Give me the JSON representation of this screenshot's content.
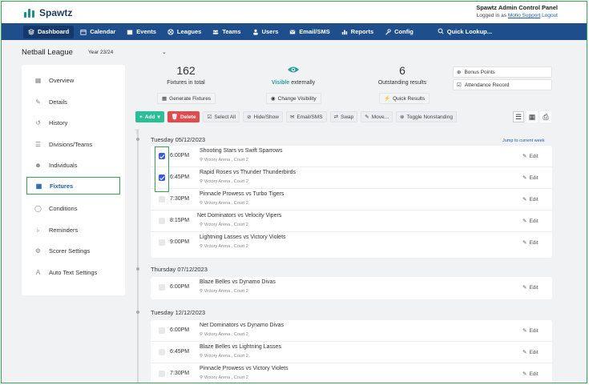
{
  "app": {
    "brand": "Spawtz",
    "admin_title": "Spawtz Admin Control Panel",
    "logged_prefix": "Logged in as",
    "user": "Motio Support",
    "logout": "Logout"
  },
  "nav": [
    {
      "label": "Dashboard",
      "icon": "layers-icon"
    },
    {
      "label": "Calendar",
      "icon": "calendar-icon"
    },
    {
      "label": "Events",
      "icon": "events-icon"
    },
    {
      "label": "Leagues",
      "icon": "ball-icon"
    },
    {
      "label": "Teams",
      "icon": "teams-icon"
    },
    {
      "label": "Users",
      "icon": "user-icon"
    },
    {
      "label": "Email/SMS",
      "icon": "envelope-icon"
    },
    {
      "label": "Reports",
      "icon": "chart-icon"
    },
    {
      "label": "Config",
      "icon": "wrench-icon"
    }
  ],
  "quick_lookup": "Quick Lookup...",
  "league": {
    "name": "Netball League",
    "season": "Year 23/24"
  },
  "sidebar": [
    {
      "label": "Overview",
      "icon": "grid-icon"
    },
    {
      "label": "Details",
      "icon": "pencil-icon"
    },
    {
      "label": "History",
      "icon": "history-icon"
    },
    {
      "label": "Divisions/Teams",
      "icon": "list-icon"
    },
    {
      "label": "Individuals",
      "icon": "people-icon"
    },
    {
      "label": "Fixtures",
      "icon": "calendar-icon"
    },
    {
      "label": "Conditions",
      "icon": "globe-icon"
    },
    {
      "label": "Reminders",
      "icon": "bell-icon"
    },
    {
      "label": "Scorer Settings",
      "icon": "gears-icon"
    },
    {
      "label": "Auto Text Settings",
      "icon": "text-icon"
    }
  ],
  "stats": {
    "fixtures_num": "162",
    "fixtures_label": "Fixtures in total",
    "visible_word": "Visible",
    "visible_rest": " externally",
    "outstanding_num": "6",
    "outstanding_label": "Outstanding results"
  },
  "stat_buttons": {
    "generate": "Generate Fixtures",
    "visibility": "Change Visibility",
    "quick_results": "Quick Results"
  },
  "right_buttons": {
    "bonus": "Bonus Points",
    "attendance": "Attendance Record"
  },
  "toolbar": {
    "add": "Add",
    "delete": "Delete",
    "select_all": "Select All",
    "hide_show": "Hide/Show",
    "email": "Email/SMS",
    "swap": "Swap",
    "move": "Move...",
    "toggle": "Toggle Nonstanding"
  },
  "jump": "Jump to current week",
  "edit_label": "Edit",
  "days": [
    {
      "date": "Tuesday 05/12/2023",
      "fixtures": [
        {
          "time": "6:00PM",
          "match": "Shooting Stars vs Swift Sparrows",
          "venue": "Victory Arena , Court 2",
          "checked": true
        },
        {
          "time": "6:45PM",
          "match": "Rapid Roses vs Thunder Thunderbirds",
          "venue": "Victory Arena , Court 2",
          "checked": true
        },
        {
          "time": "7:30PM",
          "match": "Pinnacle Prowess vs Turbo Tigers",
          "venue": "Victory Arena , Court 2",
          "checked": false
        },
        {
          "time": "8:15PM",
          "match": "Net Dominators vs Velocity Vipers",
          "venue": "Victory Arena , Court 2",
          "checked": false
        },
        {
          "time": "9:00PM",
          "match": "Lightning Lasses vs Victory Violets",
          "venue": "Victory Arena , Court 2",
          "checked": false
        }
      ]
    },
    {
      "date": "Thursday 07/12/2023",
      "fixtures": [
        {
          "time": "6:00PM",
          "match": "Blaze Belles vs Dynamo Divas",
          "venue": "Victory Arena , Court 2",
          "checked": false
        }
      ]
    },
    {
      "date": "Tuesday 12/12/2023",
      "fixtures": [
        {
          "time": "6:00PM",
          "match": "Net Dominators vs Dynamo Divas",
          "venue": "Victory Arena , Court 2",
          "checked": false
        },
        {
          "time": "6:45PM",
          "match": "Blaze Belles vs Lightning Lasses",
          "venue": "Victory Arena , Court 2",
          "checked": false
        },
        {
          "time": "7:30PM",
          "match": "Pinnacle Prowess vs Victory Violets",
          "venue": "Victory Arena , Court 2",
          "checked": false
        }
      ]
    }
  ]
}
